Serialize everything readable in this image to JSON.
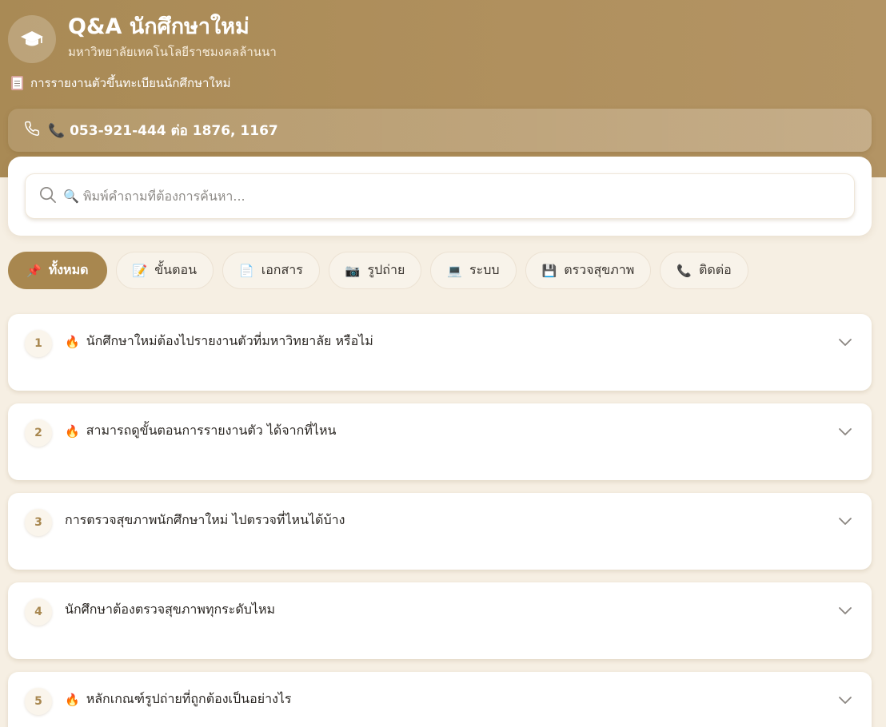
{
  "header": {
    "title": "Q&A นักศึกษาใหม่",
    "subtitle": "มหาวิทยาลัยเทคโนโลยีราชมงคลล้านนา",
    "notice": "การรายงานตัวขึ้นทะเบียนนักศึกษาใหม่",
    "logo_icon": "graduation-cap-icon"
  },
  "contact": {
    "phone_label": "📞 053-921-444 ต่อ 1876, 1167",
    "icon": "phone-icon"
  },
  "search": {
    "placeholder": "🔍 พิมพ์คำถามที่ต้องการค้นหา...",
    "value": ""
  },
  "tabs": [
    {
      "emoji": "📌",
      "label": "ทั้งหมด",
      "active": true
    },
    {
      "emoji": "📝",
      "label": "ขั้นตอน",
      "active": false
    },
    {
      "emoji": "📄",
      "label": "เอกสาร",
      "active": false
    },
    {
      "emoji": "📷",
      "label": "รูปถ่าย",
      "active": false
    },
    {
      "emoji": "💻",
      "label": "ระบบ",
      "active": false
    },
    {
      "emoji": "💾",
      "label": "ตรวจสุขภาพ",
      "active": false
    },
    {
      "emoji": "📞",
      "label": "ติดต่อ",
      "active": false
    }
  ],
  "faqs": [
    {
      "number": "1",
      "hot": "🔥",
      "question": "นักศึกษาใหม่ต้องไปรายงานตัวที่มหาวิทยาลัย หรือไม่"
    },
    {
      "number": "2",
      "hot": "🔥",
      "question": "สามารถดูขั้นตอนการรายงานตัว ได้จากที่ไหน"
    },
    {
      "number": "3",
      "hot": "",
      "question": "การตรวจสุขภาพนักศึกษาใหม่ ไปตรวจที่ไหนได้บ้าง"
    },
    {
      "number": "4",
      "hot": "",
      "question": "นักศึกษาต้องตรวจสุขภาพทุกระดับไหม"
    },
    {
      "number": "5",
      "hot": "🔥",
      "question": "หลักเกณฑ์รูปถ่ายที่ถูกต้องเป็นอย่างไร"
    }
  ],
  "colors": {
    "brand": "#a8874f",
    "header_bg": "#a98a55",
    "page_bg": "#f6efe3"
  }
}
